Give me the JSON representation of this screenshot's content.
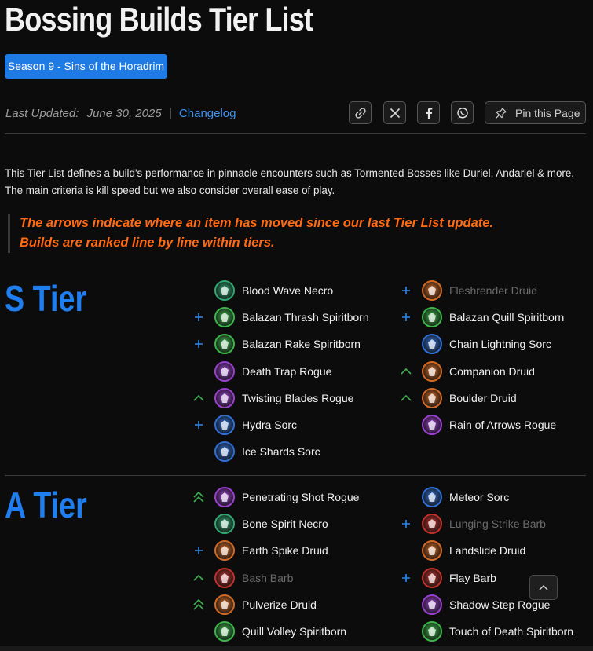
{
  "header": {
    "title": "Bossing Builds Tier List",
    "season_badge": "Season 9 - Sins of the Horadrim"
  },
  "meta": {
    "last_updated_label": "Last Updated:",
    "last_updated_date": "June 30, 2025",
    "separator": "|",
    "changelog_label": "Changelog",
    "pin_label": "Pin this Page"
  },
  "intro": {
    "line1": "This Tier List defines a build's performance in pinnacle encounters such as Tormented Bosses like Duriel, Andariel & more.",
    "line2": "The main criteria is kill speed but we also consider overall ease of play."
  },
  "callout": {
    "line1": "The arrows indicate where an item has moved since our last Tier List update.",
    "line2": "Builds are ranked line by line within tiers."
  },
  "colors": {
    "necro": "#2fa872",
    "spiritborn": "#3bb54a",
    "rogue": "#9b3fcf",
    "sorc": "#2f6fd6",
    "druid": "#d36a24",
    "barb": "#c0302a",
    "accent": "#1f7ef0",
    "callout": "#ff6a13",
    "new": "#2f86e8",
    "up": "#3fae4e"
  },
  "tiers": [
    {
      "title": "S Tier",
      "builds": [
        {
          "name": "Blood Wave Necro",
          "class": "necro",
          "move": "",
          "muted": false
        },
        {
          "name": "Fleshrender Druid",
          "class": "druid",
          "move": "new",
          "muted": true
        },
        {
          "name": "Balazan Thrash Spiritborn",
          "class": "spiritborn",
          "move": "new",
          "muted": false
        },
        {
          "name": "Balazan Quill Spiritborn",
          "class": "spiritborn",
          "move": "new",
          "muted": false
        },
        {
          "name": "Balazan Rake Spiritborn",
          "class": "spiritborn",
          "move": "new",
          "muted": false
        },
        {
          "name": "Chain Lightning Sorc",
          "class": "sorc",
          "move": "",
          "muted": false
        },
        {
          "name": "Death Trap Rogue",
          "class": "rogue",
          "move": "",
          "muted": false
        },
        {
          "name": "Companion Druid",
          "class": "druid",
          "move": "up",
          "muted": false
        },
        {
          "name": "Twisting Blades Rogue",
          "class": "rogue",
          "move": "up",
          "muted": false
        },
        {
          "name": "Boulder Druid",
          "class": "druid",
          "move": "up",
          "muted": false
        },
        {
          "name": "Hydra Sorc",
          "class": "sorc",
          "move": "new",
          "muted": false
        },
        {
          "name": "Rain of Arrows Rogue",
          "class": "rogue",
          "move": "",
          "muted": false
        },
        {
          "name": "Ice Shards Sorc",
          "class": "sorc",
          "move": "",
          "muted": false
        }
      ]
    },
    {
      "title": "A Tier",
      "builds": [
        {
          "name": "Penetrating Shot Rogue",
          "class": "rogue",
          "move": "up2",
          "muted": false
        },
        {
          "name": "Meteor Sorc",
          "class": "sorc",
          "move": "",
          "muted": false
        },
        {
          "name": "Bone Spirit Necro",
          "class": "necro",
          "move": "",
          "muted": false
        },
        {
          "name": "Lunging Strike Barb",
          "class": "barb",
          "move": "new",
          "muted": true
        },
        {
          "name": "Earth Spike Druid",
          "class": "druid",
          "move": "new",
          "muted": false
        },
        {
          "name": "Landslide Druid",
          "class": "druid",
          "move": "",
          "muted": false
        },
        {
          "name": "Bash Barb",
          "class": "barb",
          "move": "up",
          "muted": true
        },
        {
          "name": "Flay Barb",
          "class": "barb",
          "move": "new",
          "muted": false
        },
        {
          "name": "Pulverize Druid",
          "class": "druid",
          "move": "up2",
          "muted": false
        },
        {
          "name": "Shadow Step Rogue",
          "class": "rogue",
          "move": "",
          "muted": false
        },
        {
          "name": "Quill Volley Spiritborn",
          "class": "spiritborn",
          "move": "",
          "muted": false
        },
        {
          "name": "Touch of Death Spiritborn",
          "class": "spiritborn",
          "move": "",
          "muted": false
        }
      ]
    }
  ]
}
